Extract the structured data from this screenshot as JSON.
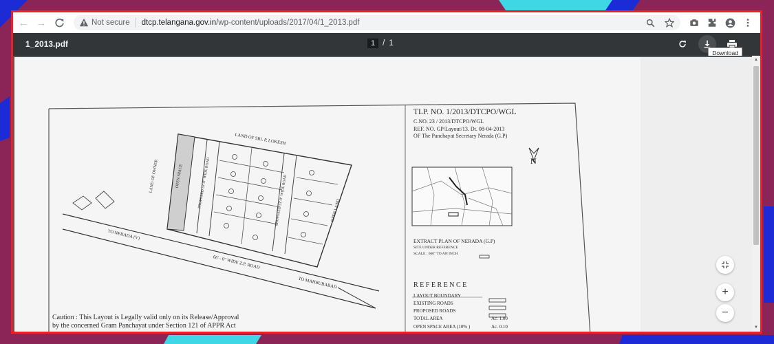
{
  "browser": {
    "security_label": "Not secure",
    "url_host": "dtcp.telangana.gov.in",
    "url_path": "/wp-content/uploads/2017/04/1_2013.pdf",
    "icons": [
      "back-icon",
      "forward-icon",
      "reload-icon",
      "zoom-icon",
      "bookmark-star-icon",
      "camera-icon",
      "extensions-icon",
      "profile-icon",
      "menu-icon"
    ]
  },
  "viewer": {
    "title": "1_2013.pdf",
    "current_page": "1",
    "page_sep": "/",
    "total_pages": "1",
    "tooltip": "Download"
  },
  "plan": {
    "tlp_no": "TLP. NO.  1/2013/DTCPO/WGL",
    "c_no": "C.NO.     23 / 2013/DTCPO/WGL",
    "ref_no": "REF. NO. GP/Layout/13. Dt. 08-04-2013",
    "of_line": "OF The  Panchayat Secretary Nerada (G.P)",
    "north": "N",
    "land_of_sri": "LAND OF SRI. P. LOKESH",
    "land_of_owner": "LAND OF OWNER",
    "open_space": "OPEN SPACE",
    "proposed_road_1": "PROPOSED 33'-0\" WIDE ROAD",
    "proposed_road_2": "PROPOSED 33'-0\" WIDE ROAD",
    "open_land": "OPEN LAND",
    "to_nerada": "TO    NERADA (V)",
    "zp_road": "66' - 0\"  WIDE  Z.P. ROAD",
    "to_mahbubabad": "TO    MAHBUBABAD",
    "extract_plan": "EXTRACT PLAN OF NERADA (G.P)",
    "site_under_ref": "SITE UNDER REFERENCE",
    "scale": "SCALE : 660\" TO AN INCH",
    "reference_heading": "R E F E R E N C E",
    "reference": [
      {
        "label": "LAYOUT BOUNDARY",
        "value": ""
      },
      {
        "label": "EXISTING ROADS",
        "value": ""
      },
      {
        "label": "PROPOSED ROADS",
        "value": ""
      },
      {
        "label": "TOTAL AREA",
        "value": "Ac.  1.00"
      },
      {
        "label": "OPEN SPACE AREA (10% )",
        "value": "Ac.  0.10"
      }
    ],
    "caution_1": "Caution : This Layout is Legally valid only on its Release/Approval",
    "caution_2": "by the concerned Gram Panchayat under Section 121 of APPR Act"
  }
}
